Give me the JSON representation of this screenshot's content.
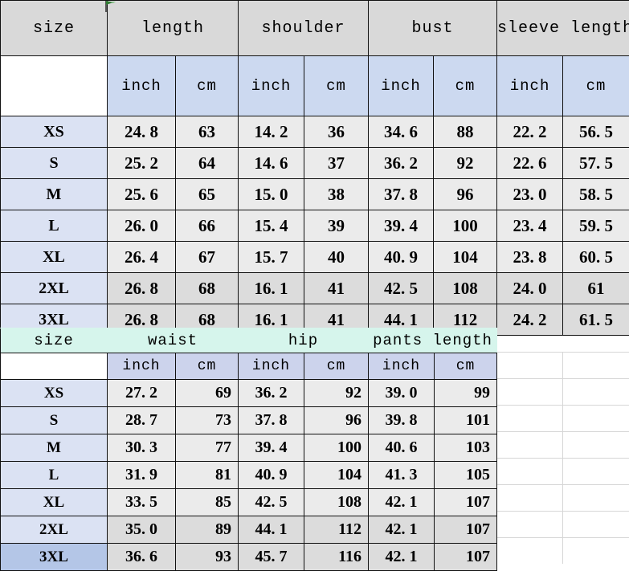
{
  "top_table": {
    "group_headers": [
      "size",
      "length",
      "shoulder",
      "bust",
      "sleeve length"
    ],
    "unit_headers": [
      "inch",
      "cm",
      "inch",
      "cm",
      "inch",
      "cm",
      "inch",
      "cm"
    ],
    "rows": [
      {
        "size": "XS",
        "cells": [
          "24. 8",
          "63",
          "14. 2",
          "36",
          "34. 6",
          "88",
          "22. 2",
          "56. 5"
        ]
      },
      {
        "size": "S",
        "cells": [
          "25. 2",
          "64",
          "14. 6",
          "37",
          "36. 2",
          "92",
          "22. 6",
          "57. 5"
        ]
      },
      {
        "size": "M",
        "cells": [
          "25. 6",
          "65",
          "15. 0",
          "38",
          "37. 8",
          "96",
          "23. 0",
          "58. 5"
        ]
      },
      {
        "size": "L",
        "cells": [
          "26. 0",
          "66",
          "15. 4",
          "39",
          "39. 4",
          "100",
          "23. 4",
          "59. 5"
        ]
      },
      {
        "size": "XL",
        "cells": [
          "26. 4",
          "67",
          "15. 7",
          "40",
          "40. 9",
          "104",
          "23. 8",
          "60. 5"
        ]
      },
      {
        "size": "2XL",
        "cells": [
          "26. 8",
          "68",
          "16. 1",
          "41",
          "42. 5",
          "108",
          "24. 0",
          "61"
        ]
      },
      {
        "size": "3XL",
        "cells": [
          "26. 8",
          "68",
          "16. 1",
          "41",
          "44. 1",
          "112",
          "24. 2",
          "61. 5"
        ]
      }
    ]
  },
  "bottom_table": {
    "group_headers": [
      "size",
      "waist",
      "hip",
      "pants length"
    ],
    "unit_headers": [
      "inch",
      "cm",
      "inch",
      "cm",
      "inch",
      "cm"
    ],
    "rows": [
      {
        "size": "XS",
        "cells": [
          "27. 2",
          "69",
          "36. 2",
          "92",
          "39. 0",
          "99"
        ]
      },
      {
        "size": "S",
        "cells": [
          "28. 7",
          "73",
          "37. 8",
          "96",
          "39. 8",
          "101"
        ]
      },
      {
        "size": "M",
        "cells": [
          "30. 3",
          "77",
          "39. 4",
          "100",
          "40. 6",
          "103"
        ]
      },
      {
        "size": "L",
        "cells": [
          "31. 9",
          "81",
          "40. 9",
          "104",
          "41. 3",
          "105"
        ]
      },
      {
        "size": "XL",
        "cells": [
          "33. 5",
          "85",
          "42. 5",
          "108",
          "42. 1",
          "107"
        ]
      },
      {
        "size": "2XL",
        "cells": [
          "35. 0",
          "89",
          "44. 1",
          "112",
          "42. 1",
          "107"
        ]
      },
      {
        "size": "3XL",
        "cells": [
          "36. 6",
          "93",
          "45. 7",
          "116",
          "42. 1",
          "107"
        ]
      }
    ]
  },
  "colors": {
    "group_header_bg": "#d9d9d9",
    "unit_header_bg": "#ccd9f0",
    "size_col_bg": "#dbe2f3",
    "value_bg": "#ebebeb",
    "value_shade_bg": "#dcdcdc",
    "mint_header_bg": "#d6f5ec",
    "highlight_row_bg": "#b4c6e7",
    "border": "#111111",
    "marker": "#2f7d32"
  },
  "marker": {
    "name": "green-flag-marker"
  }
}
